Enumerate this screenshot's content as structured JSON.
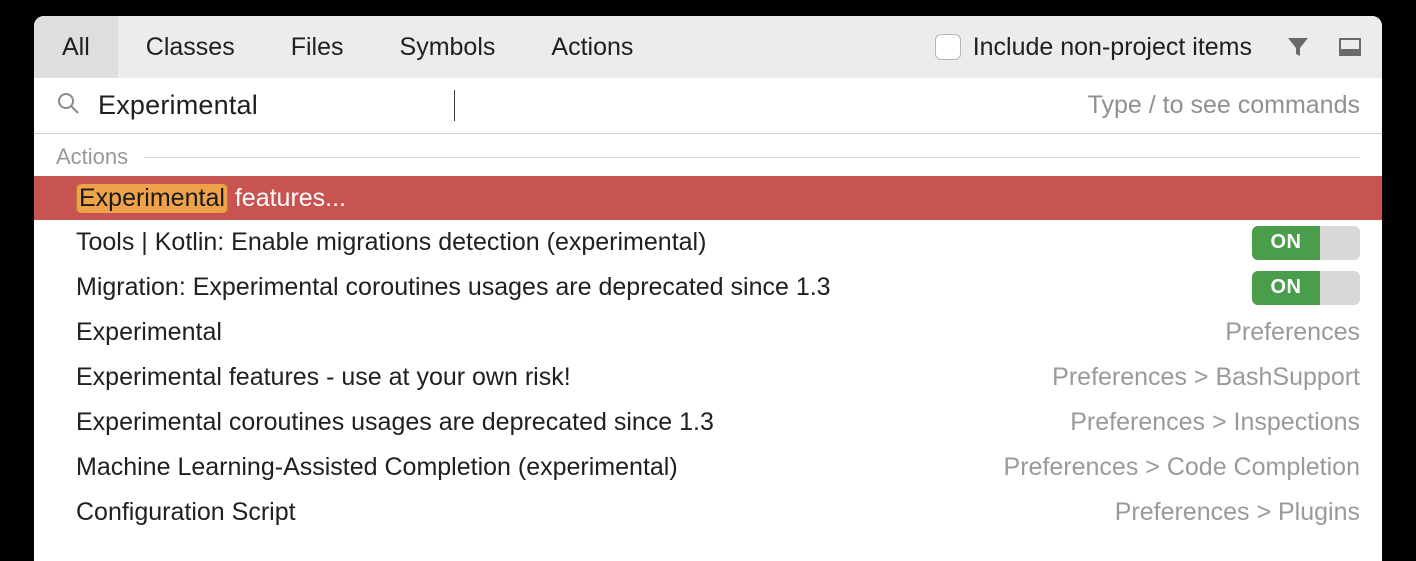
{
  "tabs": {
    "all": "All",
    "classes": "Classes",
    "files": "Files",
    "symbols": "Symbols",
    "actions": "Actions"
  },
  "include_label": "Include non-project items",
  "search": {
    "value": "Experimental",
    "hint": "Type / to see commands"
  },
  "section": "Actions",
  "selected": {
    "highlight": "Experimental",
    "rest": " features..."
  },
  "toggle_label": "ON",
  "rows": [
    {
      "label": "Tools | Kotlin: Enable migrations detection (experimental)",
      "toggle": true
    },
    {
      "label": "Migration: Experimental coroutines usages are deprecated since 1.3",
      "toggle": true
    },
    {
      "label": "Experimental",
      "path": "Preferences"
    },
    {
      "label": "Experimental features - use at your own risk!",
      "path": "Preferences > BashSupport"
    },
    {
      "label": "Experimental coroutines usages are deprecated since 1.3",
      "path": "Preferences > Inspections"
    },
    {
      "label": "Machine Learning-Assisted Completion (experimental)",
      "path": "Preferences > Code Completion"
    },
    {
      "label": "Configuration Script",
      "path": "Preferences > Plugins"
    }
  ]
}
